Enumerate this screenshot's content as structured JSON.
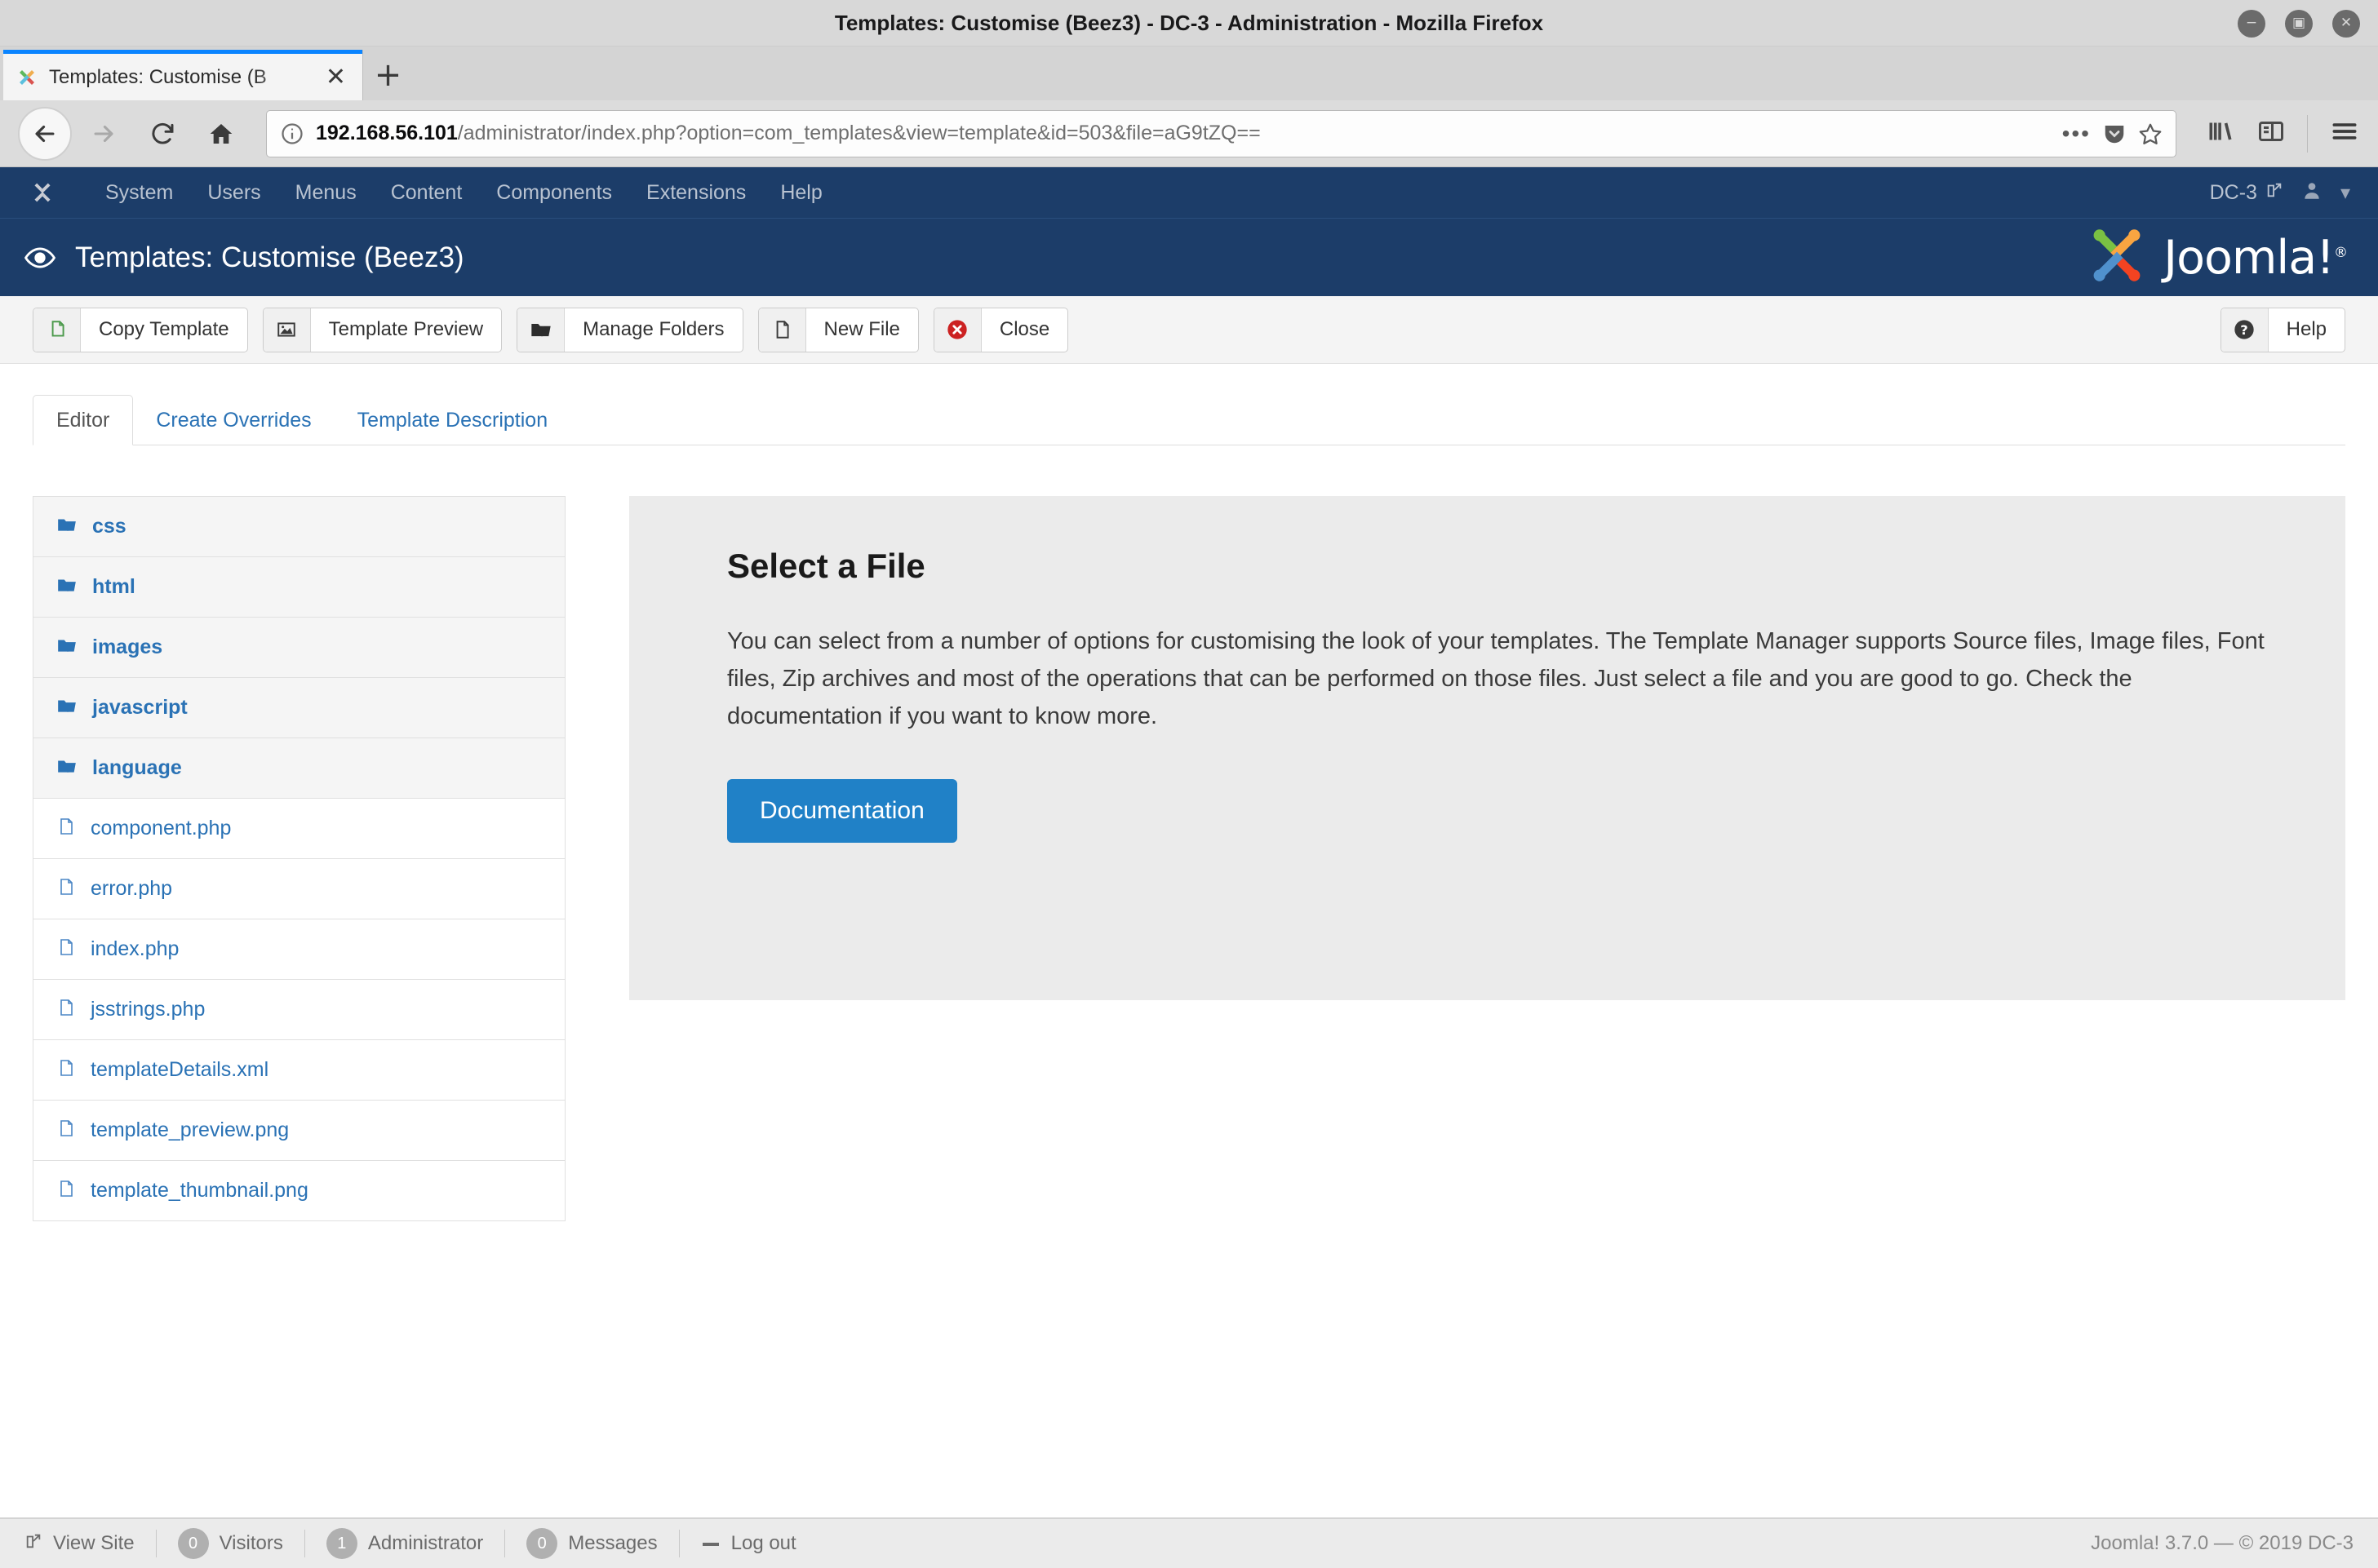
{
  "window": {
    "title": "Templates: Customise (Beez3) - DC-3 - Administration - Mozilla Firefox",
    "minimize_label": "−",
    "maximize_label": "▣",
    "close_label": "✕"
  },
  "browser": {
    "tab": {
      "title": "Templates: Customise (B",
      "favicon_name": "joomla-favicon",
      "close_label": "✕"
    },
    "new_tab_label": "+",
    "nav": {
      "back_name": "back-button",
      "forward_name": "forward-button",
      "reload_name": "reload-button",
      "home_name": "home-button"
    },
    "url": {
      "host": "192.168.56.101",
      "path": "/administrator/index.php?option=com_templates&view=template&id=503&file=aG9tZQ==",
      "full": "192.168.56.101/administrator/index.php?option=com_templates&view=template&id=503&file=aG9tZQ==",
      "info_icon": "info-icon",
      "page_actions_label": "•••",
      "pocket_icon": "pocket-icon",
      "bookmark_icon": "star-icon"
    },
    "toolbar_right": {
      "library_icon": "library-icon",
      "sidebar_icon": "sidebar-icon",
      "menu_icon": "hamburger-menu-icon"
    }
  },
  "admin_menu": {
    "brand_icon": "joomla-brand-icon",
    "items": [
      {
        "label": "System"
      },
      {
        "label": "Users"
      },
      {
        "label": "Menus"
      },
      {
        "label": "Content"
      },
      {
        "label": "Components"
      },
      {
        "label": "Extensions"
      },
      {
        "label": "Help"
      }
    ],
    "site_name": "DC-3",
    "site_link_icon": "external-link-icon",
    "user_icon": "user-icon",
    "user_caret": "▾"
  },
  "page_header": {
    "icon": "eye-icon",
    "title": "Templates: Customise (Beez3)",
    "logo_text": "Joomla!",
    "logo_reg": "®"
  },
  "toolbar": {
    "buttons": [
      {
        "label": "Copy Template",
        "icon": "copy-icon"
      },
      {
        "label": "Template Preview",
        "icon": "image-icon"
      },
      {
        "label": "Manage Folders",
        "icon": "folder-icon"
      },
      {
        "label": "New File",
        "icon": "file-icon"
      },
      {
        "label": "Close",
        "icon": "close-circle-icon"
      }
    ],
    "help": {
      "label": "Help",
      "icon": "question-circle-icon"
    }
  },
  "tabs": [
    {
      "label": "Editor",
      "active": true
    },
    {
      "label": "Create Overrides",
      "active": false
    },
    {
      "label": "Template Description",
      "active": false
    }
  ],
  "file_tree": [
    {
      "label": "css",
      "type": "folder"
    },
    {
      "label": "html",
      "type": "folder"
    },
    {
      "label": "images",
      "type": "folder"
    },
    {
      "label": "javascript",
      "type": "folder"
    },
    {
      "label": "language",
      "type": "folder"
    },
    {
      "label": "component.php",
      "type": "file"
    },
    {
      "label": "error.php",
      "type": "file"
    },
    {
      "label": "index.php",
      "type": "file"
    },
    {
      "label": "jsstrings.php",
      "type": "file"
    },
    {
      "label": "templateDetails.xml",
      "type": "file"
    },
    {
      "label": "template_preview.png",
      "type": "file"
    },
    {
      "label": "template_thumbnail.png",
      "type": "file"
    }
  ],
  "select_panel": {
    "title": "Select a File",
    "body": "You can select from a number of options for customising the look of your templates. The Template Manager supports Source files, Image files, Font files, Zip archives and most of the operations that can be performed on those files. Just select a file and you are good to go. Check the documentation if you want to know more.",
    "button_label": "Documentation"
  },
  "footer": {
    "view_site": {
      "label": "View Site",
      "icon": "external-link-icon"
    },
    "visitors": {
      "count": "0",
      "label": "Visitors"
    },
    "administrators": {
      "count": "1",
      "label": "Administrator"
    },
    "messages": {
      "count": "0",
      "label": "Messages"
    },
    "logout": {
      "label": "Log out",
      "icon": "logout-icon"
    },
    "copyright": "Joomla! 3.7.0  —  © 2019 DC-3"
  },
  "colors": {
    "joomla_navy": "#1c3d69",
    "link_blue": "#2a72b5",
    "button_blue": "#2081c7",
    "firefox_tab_accent": "#0a84ff"
  }
}
